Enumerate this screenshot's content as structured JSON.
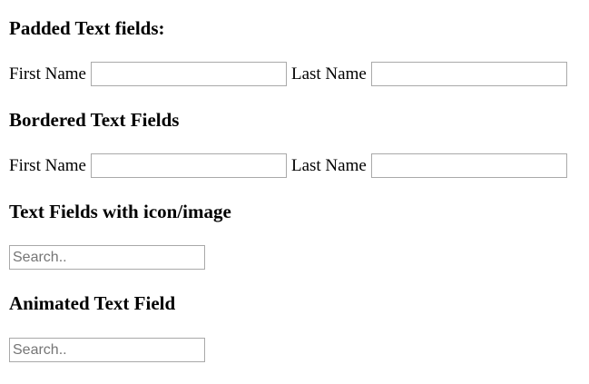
{
  "sections": [
    {
      "title": "Padded Text fields:",
      "first_label": "First Name",
      "last_label": "Last Name"
    },
    {
      "title": "Bordered Text Fields",
      "first_label": "First Name",
      "last_label": "Last Name"
    },
    {
      "title": "Text Fields with icon/image",
      "placeholder": "Search.."
    },
    {
      "title": "Animated Text Field",
      "placeholder": "Search.."
    }
  ]
}
